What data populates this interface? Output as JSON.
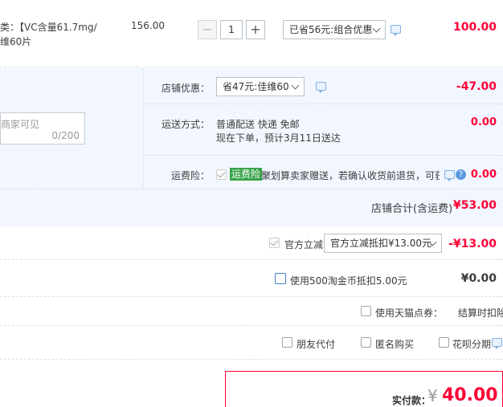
{
  "item": {
    "desc_line1": "类：【VC含量61.7mg/",
    "desc_line2": "维60片",
    "unit_price": "156.00",
    "quantity": "1",
    "minus": "−",
    "plus": "+",
    "promo_select": "已省56元:组合优惠",
    "subtotal": "100.00"
  },
  "shop": {
    "coupon_label": "店铺优惠：",
    "coupon_select": "省47元:佳维60",
    "coupon_amount": "-47.00",
    "message_placeholder": "商家可见",
    "message_count": "0/200",
    "shipping_label": "运送方式：",
    "shipping_method": "普通配送 快递 免邮",
    "shipping_eta": "现在下单，预计3月11日送达",
    "shipping_amount": "0.00",
    "insurance_label": "运费险：",
    "insurance_tag": "运费险",
    "insurance_text": "聚划算卖家赠送，若确认收货前退货，可获...",
    "insurance_amount": "0.00",
    "help_glyph": "?",
    "total_label": "店铺合计(含运费)",
    "total_amount": "¥53.00"
  },
  "platform": {
    "discount_label": "官方立减",
    "discount_select": "官方立减抵扣¥13.00元",
    "discount_amount": "-¥13.00",
    "coins_label": "使用500淘金币抵扣5.00元",
    "coins_amount": "¥0.00",
    "points_label": "使用天猫点券：",
    "points_value": "结算时扣除",
    "friend_pay": "朋友代付",
    "anonymous": "匿名购买",
    "installment": "花呗分期"
  },
  "summary": {
    "label": "实付款：",
    "currency": "¥",
    "amount": "40.00"
  }
}
